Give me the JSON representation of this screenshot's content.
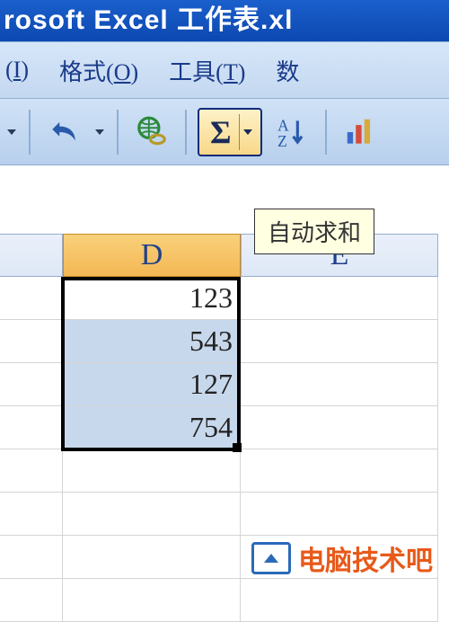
{
  "title": "rosoft Excel 工作表.xl",
  "menu": {
    "insert": {
      "prefix": "(",
      "hotkey": "I",
      "suffix": ")"
    },
    "format": {
      "label": "格式",
      "prefix": "(",
      "hotkey": "O",
      "suffix": ")"
    },
    "tools": {
      "label": "工具",
      "prefix": "(",
      "hotkey": "T",
      "suffix": ")"
    },
    "data": {
      "label": "数"
    }
  },
  "toolbar": {
    "sigma": "Σ",
    "tooltip": "自动求和"
  },
  "columns": {
    "d": "D",
    "e": "E"
  },
  "cells": {
    "d1": "123",
    "d2": "543",
    "d3": "127",
    "d4": "754"
  },
  "watermark": "电脑技术吧"
}
